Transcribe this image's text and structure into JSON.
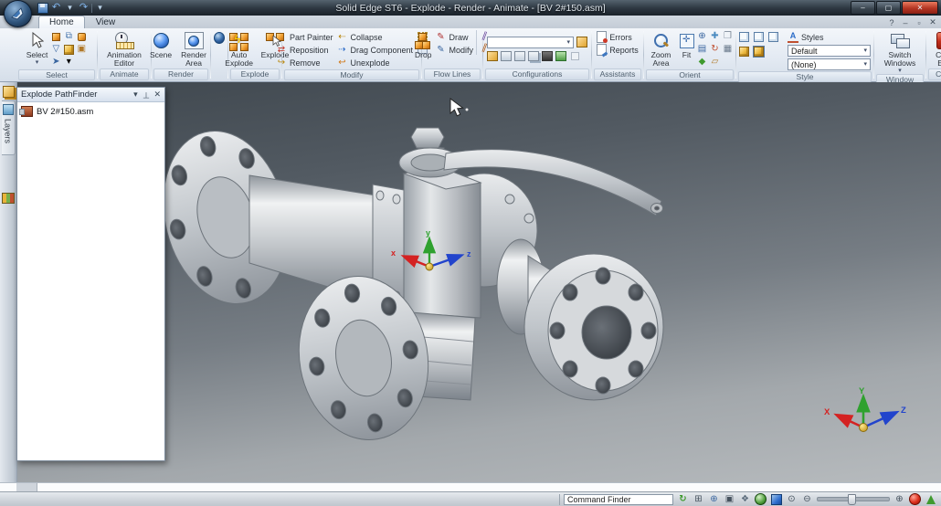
{
  "icons": {
    "dropdown": "▾",
    "undo": "↶",
    "redo": "↷",
    "help": "?",
    "win_min": "–",
    "win_max": "▢",
    "win_close": "✕",
    "doc_min": "–",
    "doc_restore": "▫",
    "doc_close": "✕",
    "pf_display": "▾",
    "pf_pin": "⊤",
    "pf_close": "✕",
    "part_painter": "✎",
    "reposition": "⇄",
    "remove": "↪",
    "collapse": "⇠",
    "drag_component": "⇢",
    "unexplode": "↩",
    "draw": "✎",
    "modify_flow": "✎",
    "flow_toggle": "∥",
    "lightning": "ϟ",
    "orient_zoom": "⊕",
    "orient_pan": "✚",
    "orient_previous": "❐",
    "orient_named": "▤",
    "orient_rotate": "↻",
    "orient_common": "▦",
    "orient_shaded": "◆",
    "orient_sketch": "▱",
    "styles_glyph": "A",
    "sb_refresh": "↻",
    "sb_zoom_area": "⊞",
    "sb_zoom": "⊕",
    "sb_fit": "▣",
    "sb_pan": "❖",
    "sb_perspective": "⊙",
    "sb_zoom_out": "⊖",
    "sb_zoom_in": "⊕"
  },
  "window": {
    "title": "Solid Edge ST6 - Explode - Render - Animate - [BV 2#150.asm]",
    "tabs": [
      {
        "label": "Home"
      },
      {
        "label": "View"
      }
    ]
  },
  "ribbon": {
    "select": {
      "label": "Select",
      "button": "Select"
    },
    "animate": {
      "label": "Animate",
      "animation_editor": "Animation Editor"
    },
    "render": {
      "label": "Render",
      "scene": "Scene",
      "render_area": "Render Area"
    },
    "explode": {
      "label": "Explode",
      "auto_explode": "Auto Explode",
      "explode": "Explode"
    },
    "modify": {
      "label": "Modify",
      "part_painter": "Part Painter",
      "reposition": "Reposition",
      "remove": "Remove",
      "collapse": "Collapse",
      "drag_component": "Drag Component",
      "unexplode": "Unexplode"
    },
    "flow_lines": {
      "label": "Flow Lines",
      "drop": "Drop",
      "draw": "Draw",
      "modify": "Modify"
    },
    "configurations": {
      "label": "Configurations",
      "combo_value": ""
    },
    "assistants": {
      "label": "Assistants",
      "errors": "Errors",
      "reports": "Reports"
    },
    "orient": {
      "label": "Orient",
      "zoom_area": "Zoom Area",
      "fit": "Fit"
    },
    "style": {
      "label": "Style",
      "styles": "Styles",
      "style_value": "Default",
      "override_value": "(None)"
    },
    "window_group": {
      "label": "Window",
      "switch_windows": "Switch Windows"
    },
    "close_group": {
      "label": "Close",
      "close_era": "Close ERA"
    }
  },
  "pathfinder": {
    "title": "Explode PathFinder",
    "items": [
      {
        "label": "BV 2#150.asm"
      }
    ]
  },
  "left_bar": {
    "layers": "Layers"
  },
  "viewport": {
    "triad": {
      "x": "x",
      "y": "y",
      "z": "z"
    },
    "corner_triad": {
      "x": "X",
      "y": "Y",
      "z": "Z"
    }
  },
  "status_bar": {
    "command_finder": "Command Finder"
  },
  "colors": {
    "close_red": "#c0362b",
    "selection_orange": "#f09c2e",
    "sphere_blue": "#2f6fd0",
    "axis_x": "#d42222",
    "axis_y": "#2fa12f",
    "axis_z": "#2244cc",
    "viewport_top": "#3f474e",
    "viewport_bottom": "#b7bbbe"
  }
}
